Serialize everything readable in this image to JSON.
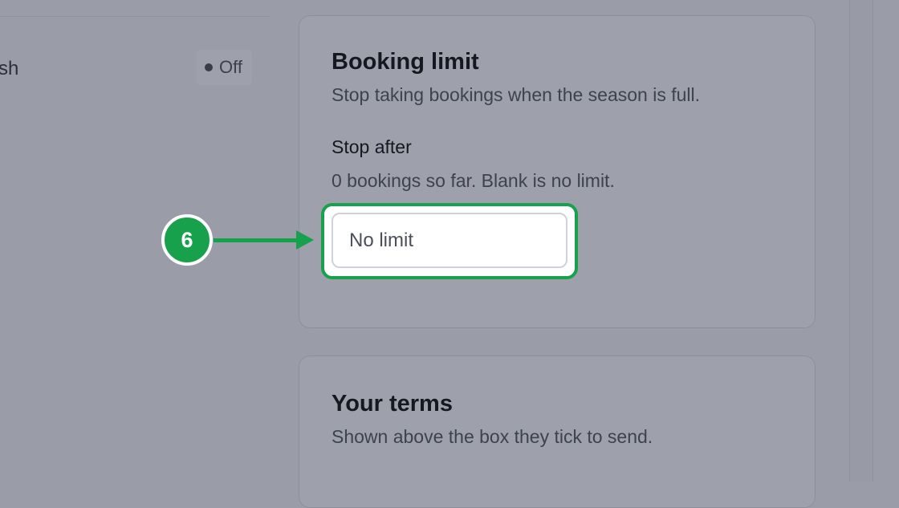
{
  "left_panel": {
    "row_label": "sh",
    "status_label": "Off"
  },
  "booking_limit_card": {
    "title": "Booking limit",
    "subtitle": "Stop taking bookings when the season is full.",
    "field_label": "Stop after",
    "field_help": "0 bookings so far. Blank is no limit.",
    "input_value": "",
    "input_placeholder": "No limit"
  },
  "terms_card": {
    "title": "Your terms",
    "subtitle": "Shown above the box they tick to send."
  },
  "annotation": {
    "step_number": "6",
    "accent_color": "#18a14d"
  }
}
